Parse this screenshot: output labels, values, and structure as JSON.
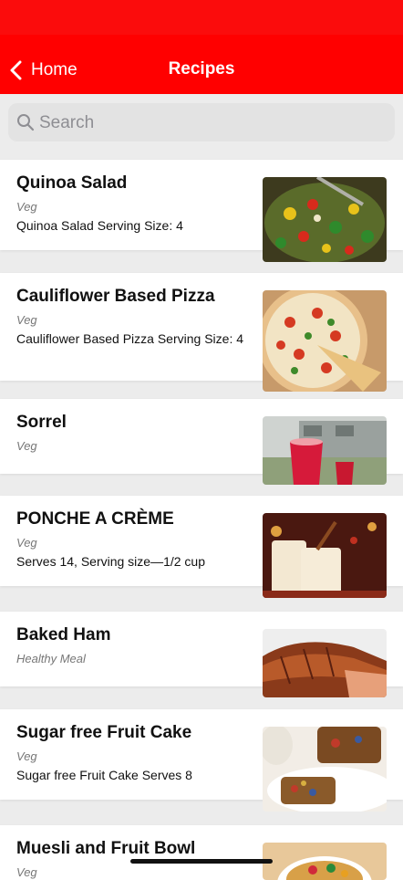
{
  "nav": {
    "back_label": "Home",
    "title": "Recipes"
  },
  "search": {
    "placeholder": "Search"
  },
  "recipes": [
    {
      "title": "Quinoa Salad",
      "category": "Veg",
      "description": "Quinoa Salad Serving Size: 4",
      "image_icon": "quinoa-salad-photo"
    },
    {
      "title": "Cauliflower Based Pizza",
      "category": "Veg",
      "description": "Cauliflower Based Pizza Serving Size: 4",
      "image_icon": "pizza-photo"
    },
    {
      "title": "Sorrel",
      "category": "Veg",
      "description": "",
      "image_icon": "sorrel-drink-photo"
    },
    {
      "title": "PONCHE A CRÈME",
      "category": "Veg",
      "description": "Serves 14, Serving size—1/2 cup",
      "image_icon": "ponche-photo"
    },
    {
      "title": "Baked Ham",
      "category": "Healthy Meal",
      "description": "",
      "image_icon": "baked-ham-photo"
    },
    {
      "title": "Sugar free Fruit Cake",
      "category": "Veg",
      "description": "Sugar free Fruit Cake Serves 8",
      "image_icon": "fruit-cake-photo"
    },
    {
      "title": "Muesli and Fruit Bowl",
      "category": "Veg",
      "description": "",
      "image_icon": "muesli-bowl-photo"
    }
  ],
  "colors": {
    "nav_red": "#ff0000",
    "status_red": "#fb0c0c",
    "background": "#ececec",
    "card": "#ffffff"
  }
}
